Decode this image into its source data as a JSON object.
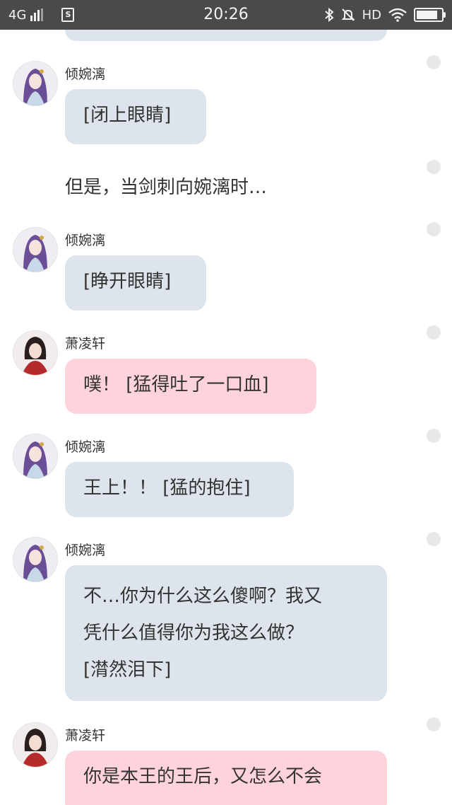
{
  "status_bar": {
    "network": "4G",
    "sim_label": "S",
    "time": "20:26",
    "hd": "HD",
    "icons": [
      "signal-icon",
      "sim-icon",
      "bluetooth-icon",
      "mute-icon",
      "wifi-icon",
      "battery-icon"
    ],
    "battery_level": 0.85
  },
  "colors": {
    "status_bg": "#4a4a4a",
    "bubble_blue": "#dde4ec",
    "bubble_pink": "#ffd3dc"
  },
  "messages": [
    {
      "name": "倾婉漓",
      "text": "[闭上眼睛]"
    },
    {
      "narration": "但是，当剑刺向婉漓时…"
    },
    {
      "name": "倾婉漓",
      "text": "[睁开眼睛]"
    },
    {
      "name": "萧凌轩",
      "text": "噗！ [猛得吐了一口血]"
    },
    {
      "name": "倾婉漓",
      "text": "王上！！ [猛的抱住]"
    },
    {
      "name": "倾婉漓",
      "lines": [
        "不…你为什么这么傻啊？我又",
        "凭什么值得你为我这么做？",
        "[潸然泪下]"
      ]
    },
    {
      "name": "萧凌轩",
      "text": "你是本王的王后，又怎么不会"
    }
  ]
}
